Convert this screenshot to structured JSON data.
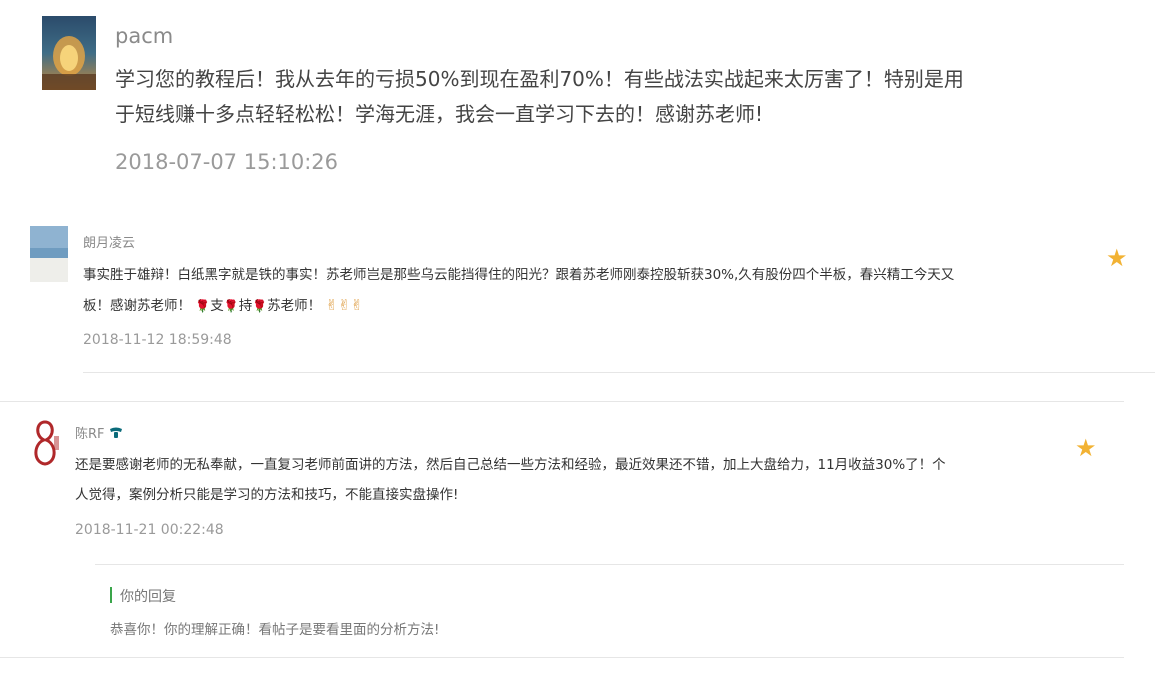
{
  "comments": [
    {
      "username": "pacm",
      "text": "学习您的教程后！我从去年的亏损50%到现在盈利70%！有些战法实战起来太厉害了！特别是用于短线赚十多点轻轻松松！学海无涯，我会一直学习下去的！感谢苏老师!",
      "time": "2018-07-07 15:10:26"
    },
    {
      "username": "朗月凌云",
      "text_a": "事实胜于雄辩！白纸黑字就是铁的事实！苏老师岂是那些乌云能挡得住的阳光？跟着苏老师刚泰控股斩获30%,久有股份四个半板，春兴精工今天又板！感谢苏老师！",
      "text_b1": "支",
      "text_b2": "持",
      "text_b3": "苏老师！",
      "rose": "🌹",
      "victory": "✌",
      "time": "2018-11-12 18:59:48",
      "star": "★"
    },
    {
      "username": "陈RF",
      "text": "还是要感谢老师的无私奉献，一直复习老师前面讲的方法，然后自己总结一些方法和经验，最近效果还不错，加上大盘给力，11月收益30%了！个人觉得，案例分析只能是学习的方法和技巧，不能直接实盘操作!",
      "time": "2018-11-21 00:22:48",
      "star": "★",
      "reply": {
        "label": "你的回复",
        "text": "恭喜你！你的理解正确！看帖子是要看里面的分析方法!"
      }
    }
  ],
  "colors": {
    "star": "#f2b233",
    "reply_bar": "#3aa54a"
  }
}
